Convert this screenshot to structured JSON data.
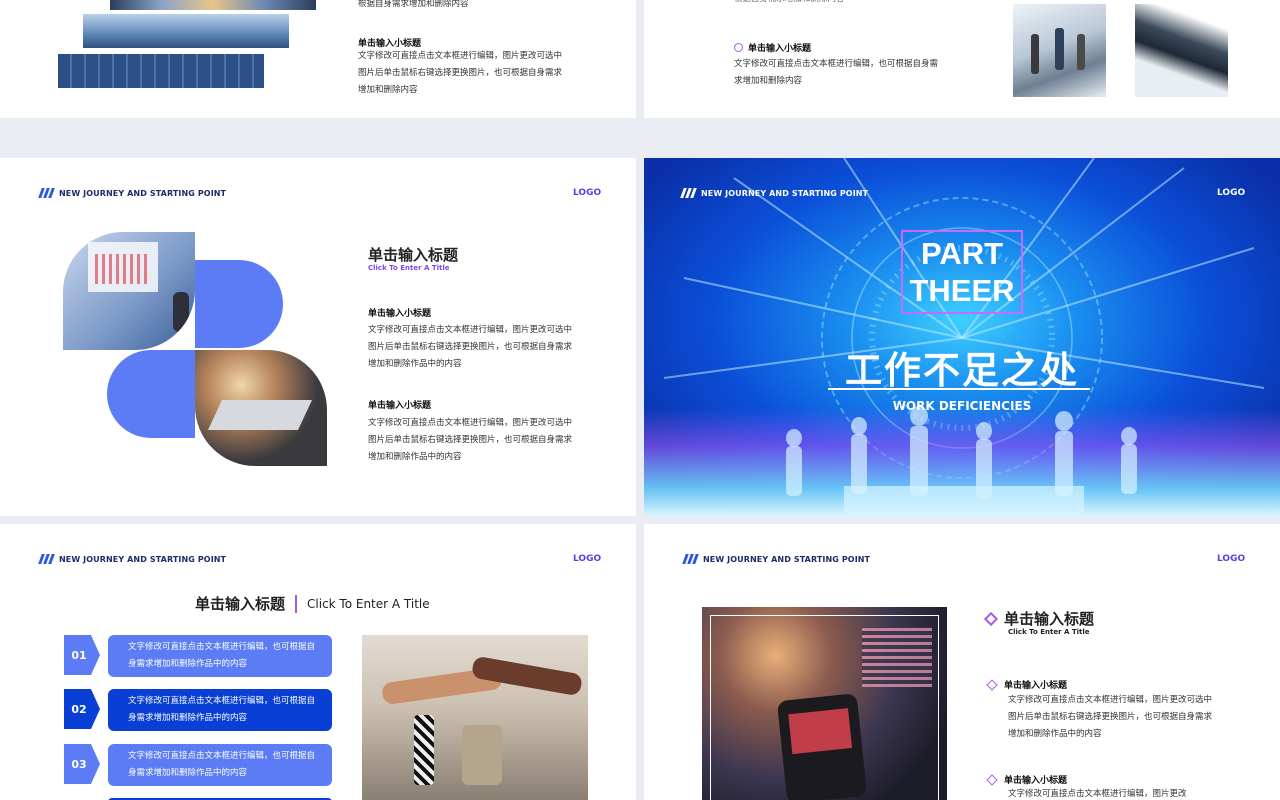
{
  "header_text": "NEW JOURNEY AND STARTING POINT",
  "logo": "LOGO",
  "title": "单击输入标题",
  "title_en": "Click To Enter A Title",
  "subtitle_label": "单击输入小标题",
  "body_short": "文字修改可直接点击文本框进行编辑，也可根据自身需求增加和删除内容",
  "body_long": "文字修改可直接点击文本框进行编辑，图片更改可选中图片后单击鼠标右键选择更换图片，也可根据自身需求增加和删除作品中的内容",
  "slide1": {
    "top_line": "根据自身需求增加和删除内容",
    "heading": "单击输入小标题",
    "body": "文字修改可直接点击文本框进行编辑，图片更改可选中图片后单击鼠标右键选择更换图片，也可根据自身需求增加和删除内容"
  },
  "slide2": {
    "top_line": "根据自身需求增加和删除内容",
    "heading": "单击输入小标题",
    "body": "文字修改可直接点击文本框进行编辑，也可根据自身需求增加和删除内容"
  },
  "slide3": {
    "items": [
      {
        "heading": "单击输入小标题",
        "body": "文字修改可直接点击文本框进行编辑，图片更改可选中图片后单击鼠标右键选择更换图片，也可根据自身需求增加和删除作品中的内容"
      },
      {
        "heading": "单击输入小标题",
        "body": "文字修改可直接点击文本框进行编辑，图片更改可选中图片后单击鼠标右键选择更换图片，也可根据自身需求增加和删除作品中的内容"
      }
    ]
  },
  "slide4": {
    "part_line1": "PART",
    "part_line2": "THEER",
    "title_cn": "工作不足之处",
    "title_en": "WORK DEFICIENCIES"
  },
  "slide5": {
    "steps": [
      {
        "num": "01",
        "text": "文字修改可直接点击文本框进行编辑，也可根据自身需求增加和删除作品中的内容"
      },
      {
        "num": "02",
        "text": "文字修改可直接点击文本框进行编辑，也可根据自身需求增加和删除作品中的内容"
      },
      {
        "num": "03",
        "text": "文字修改可直接点击文本框进行编辑，也可根据自身需求增加和删除作品中的内容"
      }
    ]
  },
  "slide6": {
    "items": [
      {
        "heading": "单击输入小标题",
        "body": "文字修改可直接点击文本框进行编辑，图片更改可选中图片后单击鼠标右键选择更换图片，也可根据自身需求增加和删除作品中的内容"
      },
      {
        "heading": "单击输入小标题",
        "body": "文字修改可直接点击文本框进行编辑，图片更改"
      }
    ]
  },
  "colors": {
    "accent_blue": "#2f56e0",
    "accent_purple": "#a45be6",
    "petal_blue": "#5b7cf5",
    "deep_blue": "#0a3fd6"
  }
}
